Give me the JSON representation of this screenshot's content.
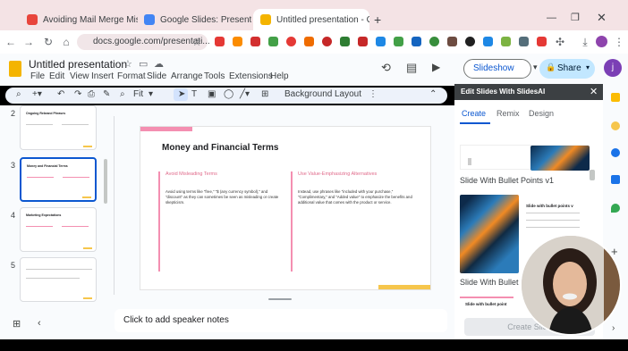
{
  "browser": {
    "tabs": [
      {
        "label": "Avoiding Mail Merge Mistakes",
        "color": "#e8453c"
      },
      {
        "label": "Google Slides: Presentation sli",
        "color": "#4285f4"
      },
      {
        "label": "Untitled presentation - Google",
        "color": "#f4b400"
      }
    ],
    "new_tab": "+",
    "url": "docs.google.com/presentati..."
  },
  "app": {
    "title": "Untitled presentation",
    "menus": [
      "File",
      "Edit",
      "View",
      "Insert",
      "Format",
      "Slide",
      "Arrange",
      "Tools",
      "Extensions",
      "Help"
    ],
    "slideshow_label": "Slideshow",
    "share_label": "Share",
    "avatar_letter": "j"
  },
  "toolbar": {
    "zoom": "Fit",
    "background_label": "Background",
    "layout_label": "Layout"
  },
  "thumbnails": [
    {
      "number": "2",
      "title": "Ongoing Rebrand Phrases",
      "selected": false
    },
    {
      "number": "3",
      "title": "Money and Financial Terms",
      "selected": true
    },
    {
      "number": "4",
      "title": "Marketing Expectations",
      "selected": false
    },
    {
      "number": "5",
      "title": "",
      "selected": false
    }
  ],
  "slide": {
    "title": "Money and Financial Terms",
    "left_heading": "Avoid Misleading Terms",
    "left_body": "Avoid using terms like \"free,\" \"$ (any currency symbol),\" and \"discount\" as they can sometimes be seen as misleading or create skepticism.",
    "right_heading": "Use Value-Emphasizing Alternatives",
    "right_body": "Instead, use phrases like \"included with your purchase,\" \"Complimentary,\" and \"Added value\" to emphasize the benefits and additional value that comes with the product or service."
  },
  "notes_placeholder": "Click to add speaker notes",
  "side_panel": {
    "header": "Edit Slides With SlidesAI",
    "tabs": [
      "Create",
      "Remix",
      "Design"
    ],
    "items": [
      {
        "label": "Slide With Bullet Points v1"
      },
      {
        "label": "Slide With Bullet Po"
      }
    ],
    "preview_title": "Slide with bullet points v",
    "preview_title_2": "Slide with bullet point",
    "create_button": "Create Slide"
  }
}
